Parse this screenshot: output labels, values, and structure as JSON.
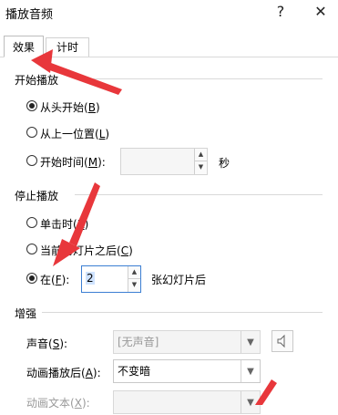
{
  "window": {
    "title": "播放音频",
    "help_label": "?",
    "close_label": "✕"
  },
  "tabs": [
    {
      "label": "效果",
      "active": true
    },
    {
      "label": "计时",
      "active": false
    }
  ],
  "start_section": {
    "title": "开始播放",
    "options": [
      {
        "label": "从头开始",
        "key": "B",
        "checked": true
      },
      {
        "label": "从上一位置",
        "key": "L",
        "checked": false
      },
      {
        "label": "开始时间",
        "key": "M",
        "checked": false
      }
    ],
    "time_value": "",
    "time_unit": "秒"
  },
  "stop_section": {
    "title": "停止播放",
    "options": [
      {
        "label": "单击时",
        "key": "K",
        "checked": false
      },
      {
        "label": "当前幻灯片之后",
        "key": "C",
        "checked": false
      },
      {
        "label": "在",
        "key": "F",
        "checked": true
      }
    ],
    "after_value": "2",
    "after_suffix": "张幻灯片后"
  },
  "enhance_section": {
    "title": "增强",
    "sound_label": "声音",
    "sound_key": "S",
    "sound_value": "[无声音]",
    "after_anim_label": "动画播放后",
    "after_anim_key": "A",
    "after_anim_value": "不变暗",
    "anim_text_label": "动画文本",
    "anim_text_key": "X"
  },
  "annotation_color": "#e8373b",
  "icons": [
    "speaker-icon",
    "chevron-down-icon",
    "spin-up-icon",
    "spin-down-icon",
    "close-icon",
    "help-icon"
  ]
}
